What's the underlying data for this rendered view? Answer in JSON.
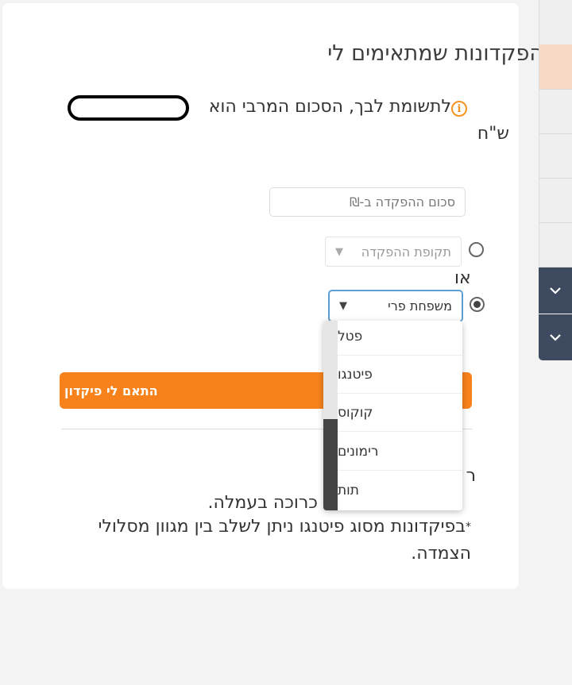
{
  "card": {
    "title": "הפקדונות שמתאימים לי",
    "notice": {
      "line1": "לתשומת לבך, הסכום המרבי הוא",
      "line2": "ש\"ח",
      "info_icon": "info-icon"
    },
    "amount_input": {
      "placeholder": "סכום ההפקדה ב-₪",
      "value": ""
    },
    "deposit_period": {
      "label": "תקופת ההפקדה",
      "selected": false
    },
    "or_label": "או",
    "fruit_family": {
      "label": "משפחת פרי",
      "selected": true
    },
    "submit_label": "התאם לי פיקדון",
    "bullets": [
      "ינה כרוכה בעמלה.",
      "בפיקדונות מסוג פיטנגו ניתן לשלב בין מגוון מסלולי",
      "הצמדה."
    ],
    "bullets_partial_header": "ר"
  },
  "dropdown": {
    "options": [
      "פטל",
      "פיטנגו",
      "קוקוס",
      "רימונים",
      "תות"
    ]
  },
  "colors": {
    "accent_orange": "#f7821b",
    "info_orange": "#f7931e",
    "focus_blue": "#5e9fd3",
    "side_dark": "#3e4a60",
    "side_highlight": "#f6dac6"
  }
}
